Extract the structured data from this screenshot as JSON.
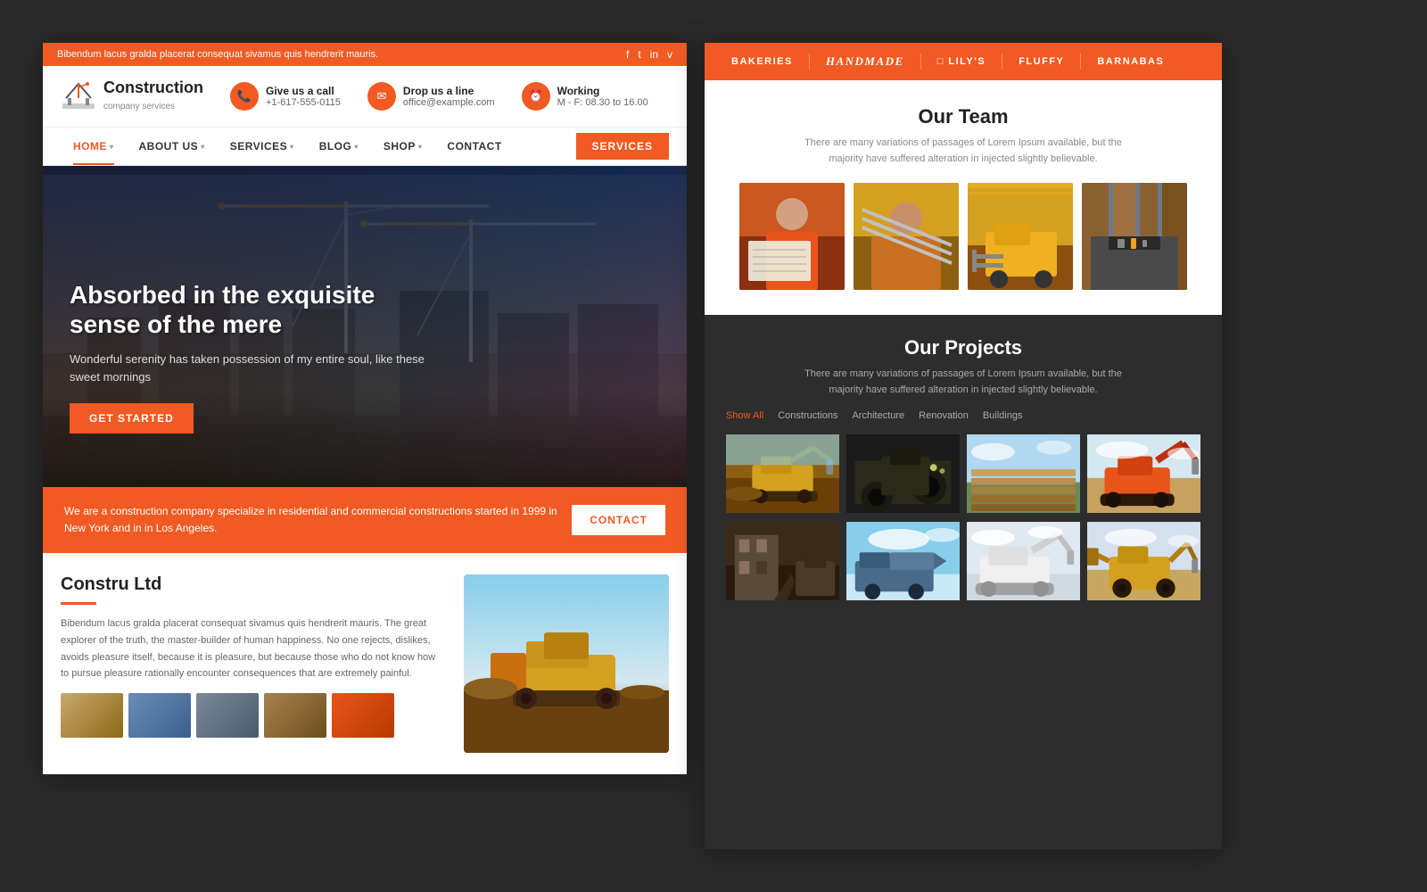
{
  "left": {
    "topbar": {
      "text": "Bibendum lacus gralda placerat consequat sivamus quis hendrerit mauris.",
      "socials": [
        "f",
        "t",
        "in",
        "v"
      ]
    },
    "header": {
      "logo": {
        "brand": "Construction",
        "tagline": "company services"
      },
      "contacts": [
        {
          "icon": "📞",
          "label": "Give us a call",
          "value": "+1-617-555-0115"
        },
        {
          "icon": "✉",
          "label": "Drop us a line",
          "value": "office@example.com"
        },
        {
          "icon": "⏰",
          "label": "Working",
          "value": "M - F: 08.30 to 16.00"
        }
      ]
    },
    "nav": {
      "items": [
        {
          "label": "HOME",
          "active": true,
          "hasArrow": true
        },
        {
          "label": "ABOUT US",
          "active": false,
          "hasArrow": true
        },
        {
          "label": "SERVICES",
          "active": false,
          "hasArrow": true
        },
        {
          "label": "BLOG",
          "active": false,
          "hasArrow": true
        },
        {
          "label": "SHOP",
          "active": false,
          "hasArrow": true
        },
        {
          "label": "CONTACT",
          "active": false,
          "hasArrow": false
        }
      ],
      "cta": "SERVICES"
    },
    "hero": {
      "title": "Absorbed in the exquisite sense of the mere",
      "subtitle": "Wonderful serenity has taken possession of my entire soul, like these sweet mornings",
      "button": "GET STARTED"
    },
    "infobar": {
      "text": "We are a construction company specialize in residential and commercial constructions  started in 1999 in New York and in in Los Angeles.",
      "button": "CONTACT"
    },
    "about": {
      "title": "Constru Ltd",
      "desc": "Bibendum lacus gralda placerat consequat sivamus quis hendrerit mauris. The great explorer of the truth, the master-builder of human happiness. No one rejects, dislikes, avoids pleasure itself, because it is pleasure, but because those who do not know how to pursue pleasure rationally encounter consequences that are extremely painful."
    }
  },
  "right": {
    "topnav": {
      "items": [
        {
          "label": "BAKERIES",
          "style": "normal"
        },
        {
          "label": "Handmade",
          "style": "italic"
        },
        {
          "label": "LILY'S",
          "style": "normal",
          "hasIcon": true
        },
        {
          "label": "FLUFFY",
          "style": "normal"
        },
        {
          "label": "BARNABAS",
          "style": "normal"
        }
      ]
    },
    "team": {
      "title": "Our Team",
      "desc": "There are many variations of passages of Lorem Ipsum available, but the majority have suffered alteration in injected slightly believable.",
      "photos": [
        "tp-1",
        "tp-2",
        "tp-3",
        "tp-4"
      ]
    },
    "projects": {
      "title": "Our Projects",
      "desc": "There are many variations of passages of Lorem Ipsum available, but the majority have suffered alteration in injected slightly believable.",
      "filters": [
        {
          "label": "Show All",
          "active": true
        },
        {
          "label": "Constructions",
          "active": false
        },
        {
          "label": "Architecture",
          "active": false
        },
        {
          "label": "Renovation",
          "active": false
        },
        {
          "label": "Buildings",
          "active": false
        }
      ],
      "cards": [
        "pc-1",
        "pc-2",
        "pc-3",
        "pc-4",
        "pc-5",
        "pc-6",
        "pc-7",
        "pc-8"
      ]
    }
  }
}
